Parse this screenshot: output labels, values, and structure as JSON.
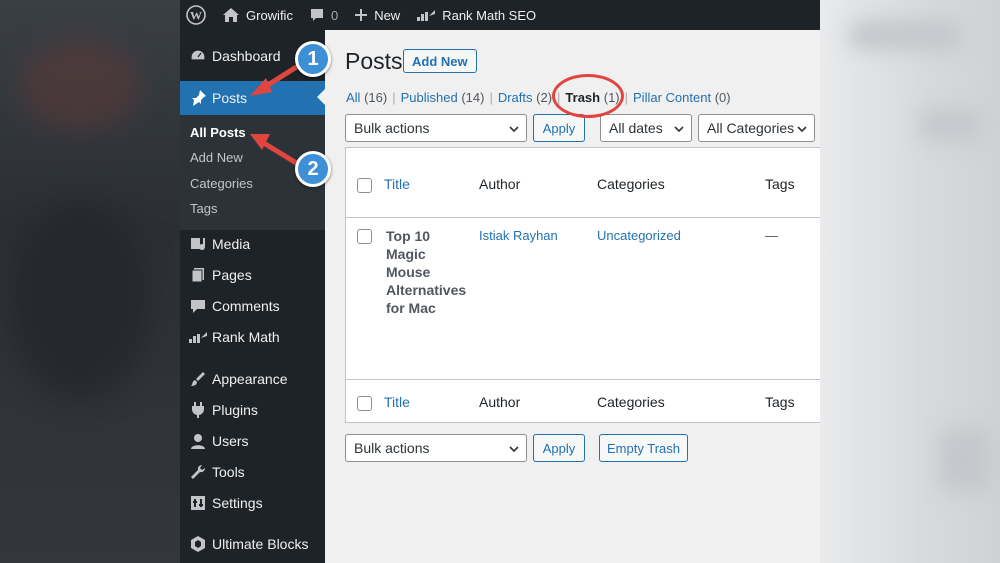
{
  "adminbar": {
    "site_name": "Growific",
    "comments_count": "0",
    "new_label": "New",
    "plugin_label": "Rank Math SEO"
  },
  "sidebar": {
    "items": [
      {
        "label": "Dashboard",
        "icon": "dashboard-icon"
      },
      {
        "label": "Posts",
        "icon": "pin-icon",
        "current": true
      },
      {
        "label": "Media",
        "icon": "media-icon"
      },
      {
        "label": "Pages",
        "icon": "pages-icon"
      },
      {
        "label": "Comments",
        "icon": "comment-icon"
      },
      {
        "label": "Rank Math",
        "icon": "rankmath-icon"
      },
      {
        "label": "Appearance",
        "icon": "brush-icon"
      },
      {
        "label": "Plugins",
        "icon": "plug-icon"
      },
      {
        "label": "Users",
        "icon": "user-icon"
      },
      {
        "label": "Tools",
        "icon": "wrench-icon"
      },
      {
        "label": "Settings",
        "icon": "settings-icon"
      },
      {
        "label": "Ultimate Blocks",
        "icon": "blocks-icon"
      }
    ],
    "submenu": [
      "All Posts",
      "Add New",
      "Categories",
      "Tags"
    ]
  },
  "content": {
    "title": "Posts",
    "add_new": "Add New",
    "filters": [
      {
        "label": "All",
        "count": "(16)"
      },
      {
        "label": "Published",
        "count": "(14)"
      },
      {
        "label": "Drafts",
        "count": "(2)"
      },
      {
        "label": "Trash",
        "count": "(1)",
        "current": true
      },
      {
        "label": "Pillar Content",
        "count": "(0)"
      }
    ],
    "bulk_actions": "Bulk actions",
    "apply": "Apply",
    "all_dates": "All dates",
    "all_categories": "All Categories",
    "empty_trash": "Empty Trash"
  },
  "table": {
    "columns": [
      "Title",
      "Author",
      "Categories",
      "Tags"
    ],
    "rows": [
      {
        "title": "Top 10 Magic Mouse Alternatives for Mac",
        "author": "Istiak Rayhan",
        "category": "Uncategorized",
        "tags": "—"
      }
    ]
  },
  "annotations": {
    "badge1": "1",
    "badge2": "2"
  },
  "colors": {
    "admin_dark": "#1d2327",
    "accent": "#2271b1",
    "annotation_red": "#e0463e",
    "badge_blue": "#3d8fd6"
  }
}
